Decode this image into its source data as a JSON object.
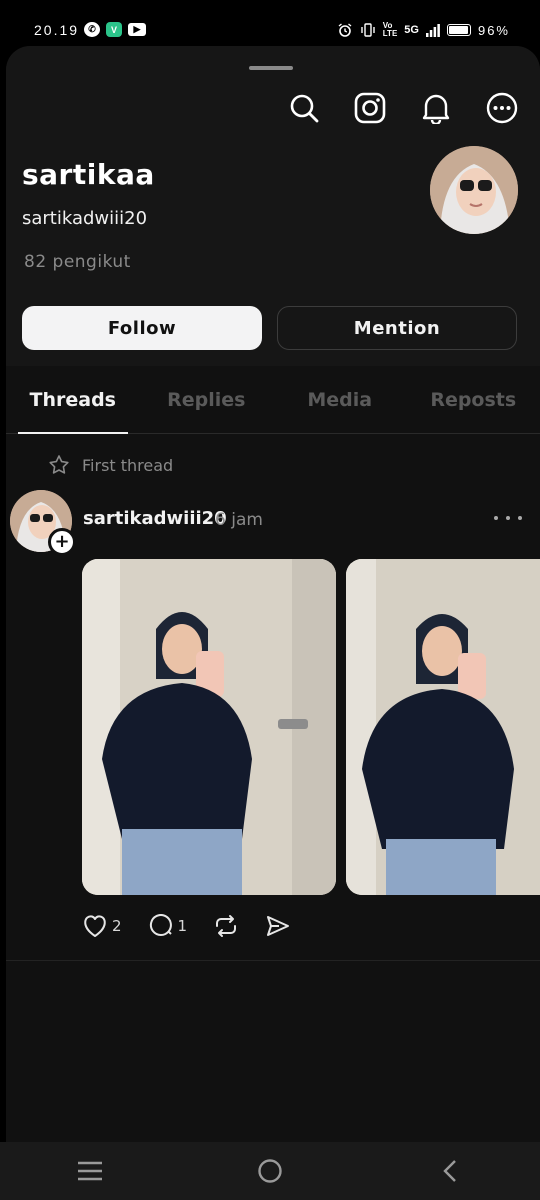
{
  "status_bar": {
    "time": "20.19",
    "network": "5G",
    "battery": "96%",
    "battery_level": 0.96
  },
  "profile": {
    "display_name": "sartikaa",
    "username": "sartikadwiii20",
    "followers": "82 pengikut",
    "follow_label": "Follow",
    "mention_label": "Mention"
  },
  "top_icons": [
    "search-icon",
    "instagram-icon",
    "bell-icon",
    "more-circle-icon"
  ],
  "tabs": [
    {
      "label": "Threads",
      "active": true
    },
    {
      "label": "Replies",
      "active": false
    },
    {
      "label": "Media",
      "active": false
    },
    {
      "label": "Reposts",
      "active": false
    }
  ],
  "post": {
    "pinned_label": "First thread",
    "username": "sartikadwiii20",
    "time": "6 jam",
    "likes": "2",
    "replies": "1"
  },
  "colors": {
    "background": "#111111",
    "profile_background": "#161616",
    "text_primary": "#f2f2f2",
    "text_secondary": "#8a8a8a",
    "follow_button": "#f3f3f4"
  }
}
